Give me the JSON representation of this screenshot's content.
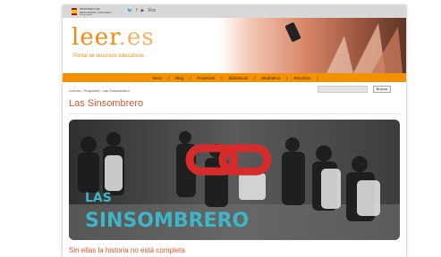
{
  "topbar": {
    "ministry_text": "MINISTERIO DE EDUCACIÓN, CULTURA Y DEPORTE",
    "social_icons": [
      "twitter-icon",
      "facebook-icon",
      "youtube-icon",
      "rss-icon"
    ],
    "social_glyphs": [
      "🐦",
      "f",
      "▶",
      "Rss"
    ]
  },
  "header": {
    "logo_main": "leer",
    "logo_dot": ".es",
    "tagline": "Portal de recursos educativos"
  },
  "nav": {
    "items": [
      "Inicio",
      "Blog",
      "Proyectos",
      "Bibliotecas",
      "Mediateca",
      "Recursos"
    ]
  },
  "breadcrumb": "Leer.es / Proyectos / Las Sinsombrero",
  "search": {
    "placeholder": "",
    "button_label": "Buscar"
  },
  "page": {
    "title": "Las Sinsombrero",
    "feature_text_line1": "LAS",
    "feature_text_line2": "SINSOMBRERO",
    "subtitle": "Sin ellas la historia no está completa"
  },
  "colors": {
    "accent": "#f39200",
    "title": "#d9542b",
    "logo": "#f28a10",
    "feature_text": "#3fb5c8",
    "link_icon": "#d62b2b"
  }
}
